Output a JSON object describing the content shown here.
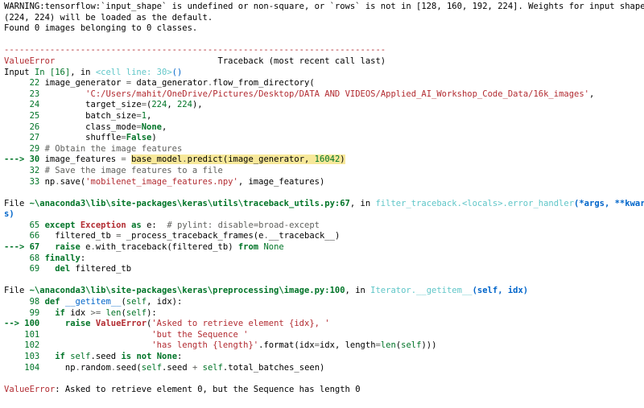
{
  "colors": {
    "red": "#b22b31",
    "green": "#007427",
    "blue": "#0065ca",
    "cyan": "#60c6c8",
    "gray": "#60615e",
    "highlight": "#f7e89a",
    "text": "#000000"
  },
  "lines": [
    [
      {
        "t": "WARNING:tensorflow:`input_shape` is undefined or non-square, or `rows` is not in [128, 160, 192, 224]. Weights for input shape"
      }
    ],
    [
      {
        "t": "(224, 224) will be loaded as the default."
      }
    ],
    [
      {
        "t": "Found 0 images belonging to 0 classes."
      }
    ],
    [
      {
        "t": ""
      }
    ],
    [
      {
        "t": "---------------------------------------------------------------------------",
        "c": "red"
      }
    ],
    [
      {
        "t": "ValueError",
        "c": "red"
      },
      {
        "t": "                                Traceback (most recent call last)"
      }
    ],
    [
      {
        "t": "Input "
      },
      {
        "t": "In [16]",
        "c": "green"
      },
      {
        "t": ", in "
      },
      {
        "t": "<cell line: 30>",
        "c": "cyan"
      },
      {
        "t": "()",
        "c": "blue"
      }
    ],
    [
      {
        "t": "     22",
        "c": "green"
      },
      {
        "t": " image_generator "
      },
      {
        "t": "=",
        "c": "gray"
      },
      {
        "t": " data_generator"
      },
      {
        "t": ".",
        "c": "gray"
      },
      {
        "t": "flow_from_directory("
      }
    ],
    [
      {
        "t": "     23",
        "c": "green"
      },
      {
        "t": "         "
      },
      {
        "t": "'C:/Users/mahit/OneDrive/Pictures/Desktop/DATA AND VIDEOS/Applied_AI_Workshop_Code_Data/16k_images'",
        "c": "red"
      },
      {
        "t": ","
      }
    ],
    [
      {
        "t": "     24",
        "c": "green"
      },
      {
        "t": "         target_size"
      },
      {
        "t": "=",
        "c": "gray"
      },
      {
        "t": "("
      },
      {
        "t": "224",
        "c": "green"
      },
      {
        "t": ", "
      },
      {
        "t": "224",
        "c": "green"
      },
      {
        "t": "),"
      }
    ],
    [
      {
        "t": "     25",
        "c": "green"
      },
      {
        "t": "         batch_size"
      },
      {
        "t": "=",
        "c": "gray"
      },
      {
        "t": "1",
        "c": "green"
      },
      {
        "t": ","
      }
    ],
    [
      {
        "t": "     26",
        "c": "green"
      },
      {
        "t": "         class_mode"
      },
      {
        "t": "=",
        "c": "gray"
      },
      {
        "t": "None",
        "c": "green",
        "b": true
      },
      {
        "t": ","
      }
    ],
    [
      {
        "t": "     27",
        "c": "green"
      },
      {
        "t": "         shuffle"
      },
      {
        "t": "=",
        "c": "gray"
      },
      {
        "t": "False",
        "c": "green",
        "b": true
      },
      {
        "t": ")"
      }
    ],
    [
      {
        "t": "     29",
        "c": "green"
      },
      {
        "t": " "
      },
      {
        "t": "# Obtain the image features",
        "c": "gray"
      }
    ],
    [
      {
        "t": "---> 30",
        "c": "green",
        "b": true
      },
      {
        "t": " image_features "
      },
      {
        "t": "=",
        "c": "gray"
      },
      {
        "t": " "
      },
      {
        "t": "base_model",
        "h": true
      },
      {
        "t": ".",
        "c": "gray",
        "h": true
      },
      {
        "t": "predict(image_generator, ",
        "h": true
      },
      {
        "t": "16042",
        "c": "green",
        "h": true
      },
      {
        "t": ")",
        "h": true
      }
    ],
    [
      {
        "t": "     32",
        "c": "green"
      },
      {
        "t": " "
      },
      {
        "t": "# Save the image features to a file",
        "c": "gray"
      }
    ],
    [
      {
        "t": "     33",
        "c": "green"
      },
      {
        "t": " np"
      },
      {
        "t": ".",
        "c": "gray"
      },
      {
        "t": "save("
      },
      {
        "t": "'mobilenet_image_features.npy'",
        "c": "red"
      },
      {
        "t": ", image_features)"
      }
    ],
    [
      {
        "t": ""
      }
    ],
    [
      {
        "t": "File "
      },
      {
        "t": "~\\anaconda3\\lib\\site-packages\\keras\\utils\\traceback_utils.py:67",
        "c": "green",
        "b": true
      },
      {
        "t": ", in "
      },
      {
        "t": "filter_traceback.<locals>.error_handler",
        "c": "cyan"
      },
      {
        "t": "(*args, **kwarg",
        "c": "blue",
        "b": true
      }
    ],
    [
      {
        "t": "s)",
        "c": "blue",
        "b": true
      }
    ],
    [
      {
        "t": "     65",
        "c": "green"
      },
      {
        "t": " "
      },
      {
        "t": "except",
        "c": "green",
        "b": true
      },
      {
        "t": " "
      },
      {
        "t": "Exception",
        "c": "red",
        "b": true
      },
      {
        "t": " "
      },
      {
        "t": "as",
        "c": "green",
        "b": true
      },
      {
        "t": " e:  "
      },
      {
        "t": "# pylint: disable=broad-except",
        "c": "gray"
      }
    ],
    [
      {
        "t": "     66",
        "c": "green"
      },
      {
        "t": "   filtered_tb "
      },
      {
        "t": "=",
        "c": "gray"
      },
      {
        "t": " _process_traceback_frames(e"
      },
      {
        "t": ".",
        "c": "gray"
      },
      {
        "t": "__traceback__)"
      }
    ],
    [
      {
        "t": "---> 67",
        "c": "green",
        "b": true
      },
      {
        "t": "   "
      },
      {
        "t": "raise",
        "c": "green",
        "b": true
      },
      {
        "t": " e"
      },
      {
        "t": ".",
        "c": "gray"
      },
      {
        "t": "with_traceback(filtered_tb) "
      },
      {
        "t": "from",
        "c": "green",
        "b": true
      },
      {
        "t": " "
      },
      {
        "t": "None",
        "c": "green"
      }
    ],
    [
      {
        "t": "     68",
        "c": "green"
      },
      {
        "t": " "
      },
      {
        "t": "finally",
        "c": "green",
        "b": true
      },
      {
        "t": ":"
      }
    ],
    [
      {
        "t": "     69",
        "c": "green"
      },
      {
        "t": "   "
      },
      {
        "t": "del",
        "c": "green",
        "b": true
      },
      {
        "t": " filtered_tb"
      }
    ],
    [
      {
        "t": ""
      }
    ],
    [
      {
        "t": "File "
      },
      {
        "t": "~\\anaconda3\\lib\\site-packages\\keras\\preprocessing\\image.py:100",
        "c": "green",
        "b": true
      },
      {
        "t": ", in "
      },
      {
        "t": "Iterator.__getitem__",
        "c": "cyan"
      },
      {
        "t": "(self, idx)",
        "c": "blue",
        "b": true
      }
    ],
    [
      {
        "t": "     98",
        "c": "green"
      },
      {
        "t": " "
      },
      {
        "t": "def",
        "c": "green",
        "b": true
      },
      {
        "t": " "
      },
      {
        "t": "__getitem__",
        "c": "blue"
      },
      {
        "t": "("
      },
      {
        "t": "self",
        "c": "green"
      },
      {
        "t": ", idx):"
      }
    ],
    [
      {
        "t": "     99",
        "c": "green"
      },
      {
        "t": "   "
      },
      {
        "t": "if",
        "c": "green",
        "b": true
      },
      {
        "t": " idx "
      },
      {
        "t": ">=",
        "c": "gray"
      },
      {
        "t": " "
      },
      {
        "t": "len",
        "c": "green"
      },
      {
        "t": "("
      },
      {
        "t": "self",
        "c": "green"
      },
      {
        "t": "):"
      }
    ],
    [
      {
        "t": "--> 100",
        "c": "green",
        "b": true
      },
      {
        "t": "     "
      },
      {
        "t": "raise",
        "c": "green",
        "b": true
      },
      {
        "t": " "
      },
      {
        "t": "ValueError",
        "c": "red",
        "b": true
      },
      {
        "t": "("
      },
      {
        "t": "'Asked to retrieve element {idx}, '",
        "c": "red"
      }
    ],
    [
      {
        "t": "    101",
        "c": "green"
      },
      {
        "t": "                      "
      },
      {
        "t": "'but the Sequence '",
        "c": "red"
      }
    ],
    [
      {
        "t": "    102",
        "c": "green"
      },
      {
        "t": "                      "
      },
      {
        "t": "'has length {length}'",
        "c": "red"
      },
      {
        "t": "."
      },
      {
        "t": "format(idx"
      },
      {
        "t": "=",
        "c": "gray"
      },
      {
        "t": "idx, length"
      },
      {
        "t": "=",
        "c": "gray"
      },
      {
        "t": "len",
        "c": "green"
      },
      {
        "t": "("
      },
      {
        "t": "self",
        "c": "green"
      },
      {
        "t": ")))"
      }
    ],
    [
      {
        "t": "    103",
        "c": "green"
      },
      {
        "t": "   "
      },
      {
        "t": "if",
        "c": "green",
        "b": true
      },
      {
        "t": " "
      },
      {
        "t": "self",
        "c": "green"
      },
      {
        "t": "."
      },
      {
        "t": "seed "
      },
      {
        "t": "is",
        "c": "green",
        "b": true
      },
      {
        "t": " "
      },
      {
        "t": "not",
        "c": "green",
        "b": true
      },
      {
        "t": " "
      },
      {
        "t": "None",
        "c": "green",
        "b": true
      },
      {
        "t": ":"
      }
    ],
    [
      {
        "t": "    104",
        "c": "green"
      },
      {
        "t": "     np"
      },
      {
        "t": ".",
        "c": "gray"
      },
      {
        "t": "random"
      },
      {
        "t": ".",
        "c": "gray"
      },
      {
        "t": "seed("
      },
      {
        "t": "self",
        "c": "green"
      },
      {
        "t": "."
      },
      {
        "t": "seed "
      },
      {
        "t": "+",
        "c": "gray"
      },
      {
        "t": " "
      },
      {
        "t": "self",
        "c": "green"
      },
      {
        "t": "."
      },
      {
        "t": "total_batches_seen)"
      }
    ],
    [
      {
        "t": ""
      }
    ],
    [
      {
        "t": "ValueError",
        "c": "red"
      },
      {
        "t": ": Asked to retrieve element 0, but the Sequence has length 0"
      }
    ]
  ]
}
